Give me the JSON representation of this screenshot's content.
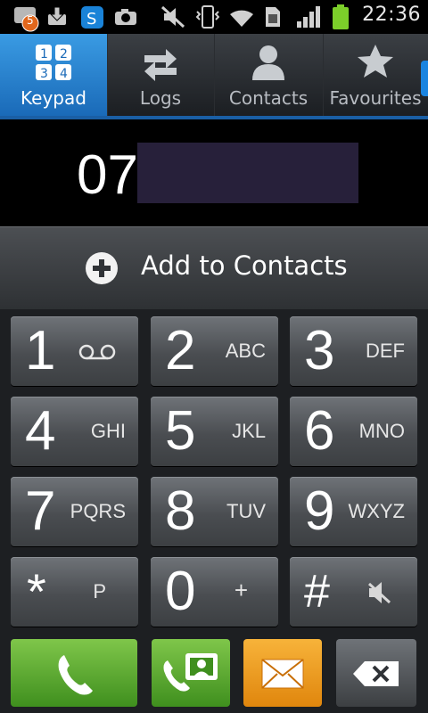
{
  "status_bar": {
    "notification_badge": "5",
    "time": "22:36",
    "icons": [
      "notification-icon",
      "download-icon",
      "skype-icon",
      "camera-icon",
      "mute-icon",
      "vibrate-icon",
      "wifi-icon",
      "sim-icon",
      "signal-icon",
      "battery-icon"
    ]
  },
  "tabs": [
    {
      "label": "Keypad",
      "icon": "keypad-icon",
      "active": true
    },
    {
      "label": "Logs",
      "icon": "logs-icon",
      "active": false
    },
    {
      "label": "Contacts",
      "icon": "contacts-icon",
      "active": false
    },
    {
      "label": "Favourites",
      "icon": "star-icon",
      "active": false
    }
  ],
  "tab_keypad_digits": [
    "1",
    "2",
    "3",
    "4"
  ],
  "display": {
    "number": "07"
  },
  "add_contacts": {
    "label": "Add to Contacts"
  },
  "keys": [
    {
      "digit": "1",
      "letters": ""
    },
    {
      "digit": "2",
      "letters": "ABC"
    },
    {
      "digit": "3",
      "letters": "DEF"
    },
    {
      "digit": "4",
      "letters": "GHI"
    },
    {
      "digit": "5",
      "letters": "JKL"
    },
    {
      "digit": "6",
      "letters": "MNO"
    },
    {
      "digit": "7",
      "letters": "PQRS"
    },
    {
      "digit": "8",
      "letters": "TUV"
    },
    {
      "digit": "9",
      "letters": "WXYZ"
    },
    {
      "digit": "*",
      "letters": "P"
    },
    {
      "digit": "0",
      "letters": "+"
    },
    {
      "digit": "#",
      "letters": ""
    }
  ],
  "actions": [
    "call",
    "video-call",
    "message",
    "backspace"
  ],
  "colors": {
    "accent_blue": "#1a6ab8",
    "call_green": "#3f8f1e",
    "message_orange": "#e0860d"
  }
}
